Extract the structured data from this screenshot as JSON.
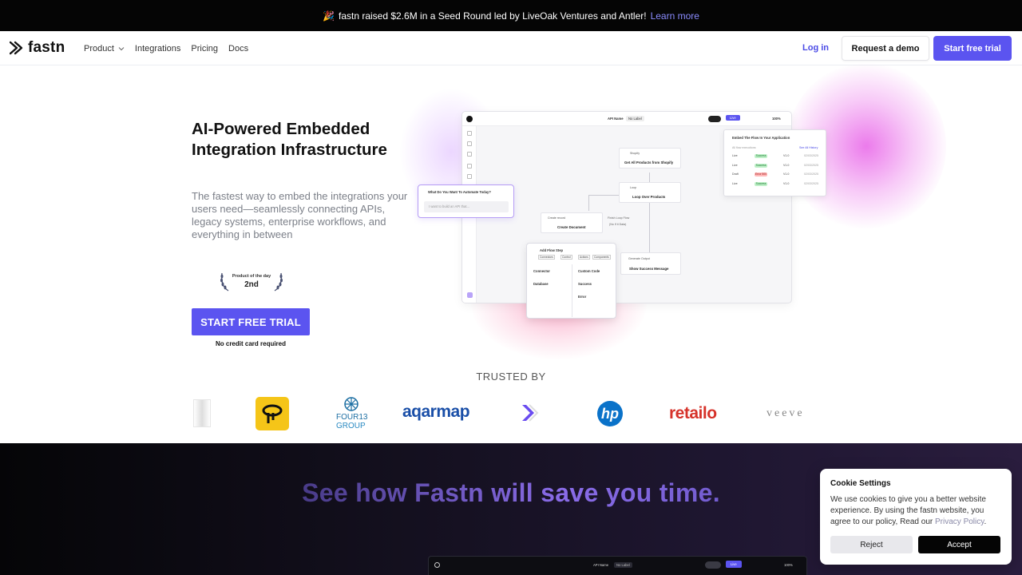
{
  "announcement": {
    "emoji": "🎉",
    "text": "fastn raised $2.6M in a Seed Round led by LiveOak Ventures and Antler!",
    "link": "Learn more"
  },
  "nav": {
    "brand": "fastn",
    "links": [
      "Product",
      "Integrations",
      "Pricing",
      "Docs"
    ],
    "login": "Log in",
    "demo": "Request a demo",
    "trial": "Start free trial"
  },
  "hero": {
    "title": "AI-Powered Embedded Integration Infrastructure",
    "subtitle": "The fastest way to embed the integrations your users need—seamlessly connecting APIs, legacy systems, enterprise workflows, and everything in between",
    "badge_line1": "Product of the day",
    "badge_line2": "2nd",
    "cta": "START FREE TRIAL",
    "cta_note": "No credit card required"
  },
  "mockup": {
    "api_name": "API Name",
    "no_label": "No Label",
    "live": "Live",
    "zoom": "100%",
    "node_shopify": "Shopify",
    "node_get_products": "Get All Products from Shopify",
    "node_loop_tag": "Loop",
    "node_loop": "Loop Over Products",
    "node_create_tag": "Create record",
    "node_create": "Create Document",
    "node_loop_end": "Finish Loop Flow",
    "node_loop_end2": "(No If it Data)",
    "node_success_tag": "Generate Output",
    "node_success": "Show Success Message",
    "ask_title": "What Do You Want To Automate Today?",
    "ask_placeholder": "I want to build an API that...",
    "status_title": "Embed The Flow In Your Application",
    "status_sub": "All flow executions",
    "status_link": "See All History",
    "status_rows": [
      {
        "env": "Live",
        "status": "Success",
        "ver": "V1.0",
        "date": "02/03/2025"
      },
      {
        "env": "Live",
        "status": "Success",
        "ver": "V1.0",
        "date": "02/03/2025"
      },
      {
        "env": "Draft",
        "status": "Error 500",
        "ver": "V1.0",
        "date": "02/03/2025"
      },
      {
        "env": "Live",
        "status": "Success",
        "ver": "V1.0",
        "date": "02/03/2025"
      }
    ],
    "step_title": "Add Flow Step",
    "step_tabs": [
      "Connectors",
      "Control",
      "Actions",
      "Components"
    ],
    "step_items_left": [
      "Connector",
      "Database"
    ],
    "step_items_right": [
      "Custom Code",
      "Success",
      "Error"
    ]
  },
  "trusted": {
    "heading": "TRUSTED BY",
    "logos": [
      "four13-group",
      "aqarmap",
      "hp",
      "retailo",
      "veeve"
    ],
    "four13_line1": "FOUR13",
    "four13_line2": "GROUP",
    "aqarmap": "aqarmap",
    "hp": "hp",
    "retailo": "retailo",
    "veeve": "veeve"
  },
  "section2": {
    "title": "See how Fastn will save you time."
  },
  "cookie": {
    "title": "Cookie Settings",
    "text": "We use cookies to give you a better website experience. By using the fastn website, you agree to our policy, Read our",
    "policy_link": "Privacy Policy",
    "reject": "Reject",
    "accept": "Accept"
  },
  "colors": {
    "accent": "#5b54f0",
    "login": "#4b4be6",
    "announce_bg": "#050505",
    "link": "#8b8cff"
  }
}
